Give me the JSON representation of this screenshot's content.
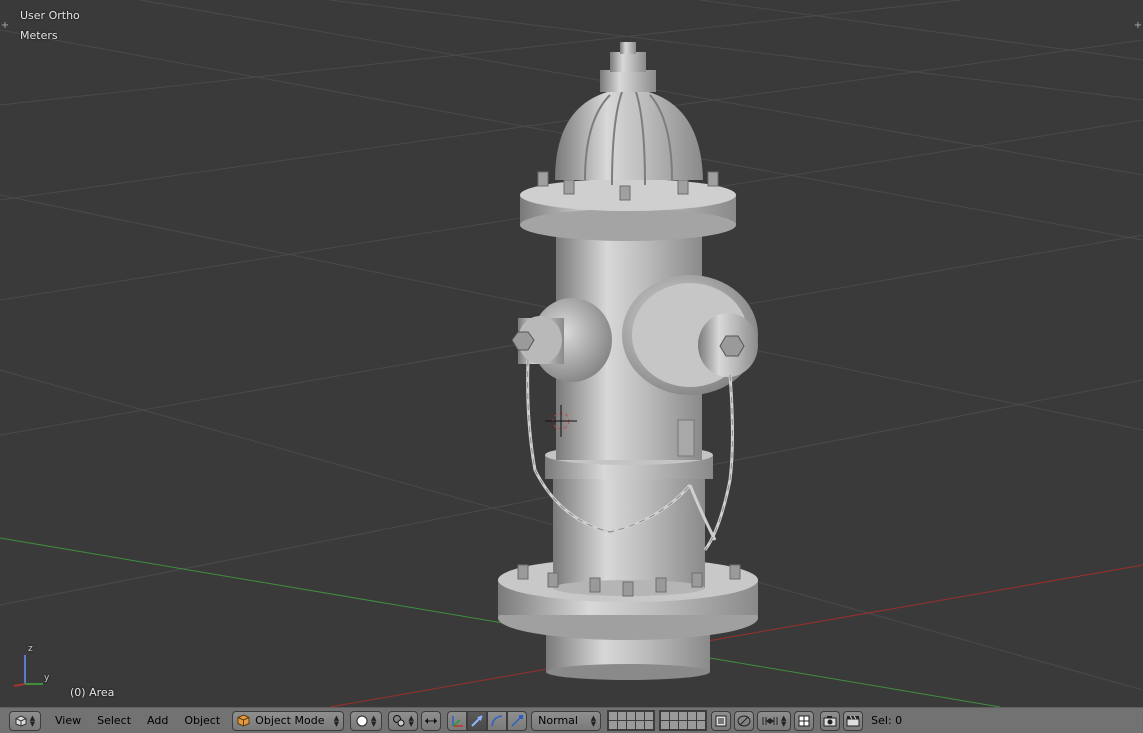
{
  "viewport": {
    "view_name": "User Ortho",
    "units": "Meters",
    "object_info": "(0) Area",
    "axis": {
      "z": "z",
      "y": "y"
    }
  },
  "header": {
    "menus": {
      "view": "View",
      "select": "Select",
      "add": "Add",
      "object": "Object"
    },
    "mode": "Object Mode",
    "pivot_orientation": "Normal",
    "selection": "Sel: 0"
  },
  "icons": {
    "editor_type": "3d-view-cube-icon",
    "mode": "object-mode-cube-icon",
    "shading": "solid-sphere-icon",
    "pivot": "pivot-point-icon",
    "manipulator": "manipulator-icon",
    "translate": "translate-arrow-icon",
    "rotate": "rotate-arc-icon",
    "scale": "scale-arrow-icon",
    "layers_a": "layers-grid-icon",
    "layers_b": "layers-grid-icon",
    "layer_lock": "layer-lock-icon",
    "proportional": "proportional-edit-icon",
    "snap": "snap-magnet-icon",
    "snap_element": "snap-element-icon",
    "render": "render-camera-icon",
    "render_anim": "render-clapper-icon"
  },
  "colors": {
    "viewport_bg": "#3a3a3a",
    "grid": "#4a4a4a",
    "x_axis": "#9a2f2f",
    "y_axis": "#3f8f3f",
    "header_bg": "#727272"
  }
}
